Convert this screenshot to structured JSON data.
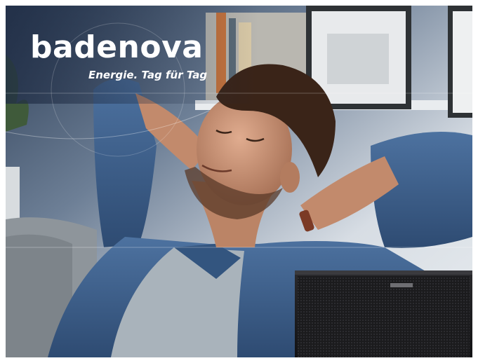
{
  "ad": {
    "brand": "badenova",
    "tagline": "Energie. Tag für Tag",
    "scene_description_icon": "relaxing-man-photo",
    "product_logo_icon": "heat-pump-brand-logo"
  },
  "colors": {
    "background_wall": "#c9d3de",
    "shirt_denim": "#3d5f8a",
    "tshirt": "#a9b3bb",
    "sofa": "#8e959b",
    "skin": "#c48f74",
    "hair": "#3a2418",
    "heat_pump": "#1d1d1f",
    "text": "#ffffff"
  }
}
